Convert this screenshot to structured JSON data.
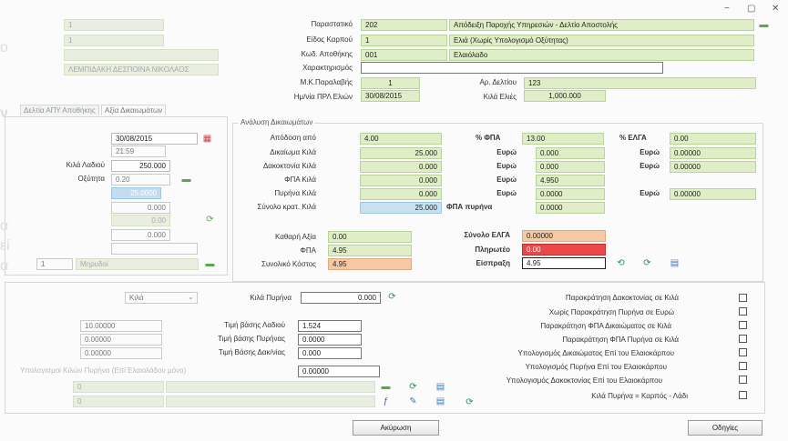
{
  "background": {
    "line1": "ο",
    "line2": "ν",
    "line3": "α",
    "line4": "εί",
    "line5": "α"
  },
  "window_controls": {
    "minimize": "−",
    "maximize": "▢",
    "close": "✕"
  },
  "left_faded": {
    "code1": "1",
    "code2": "1",
    "name": "ΛΕΜΠΙΔΑΚΗ ΔΕΣΠΟΙΝΑ ΝΙΚΟΛΑΟΣ",
    "tab1": "Δελτία ΑΠΥ Αποθήκης",
    "tab2": "Αξία Δικαιωμάτων"
  },
  "header": {
    "parastatiko_label": "Παραστατικό",
    "parastatiko_code": "202",
    "parastatiko_desc": "Απόδειξη Παροχής Υπηρεσιών - Δελτίο Αποστολής",
    "eidos_label": "Είδος Καρπού",
    "eidos_code": "1",
    "eidos_desc": "Ελιά (Χωρίς Υπολογισμό Οξύτητας)",
    "kod_label": "Κωδ. Αποθήκης",
    "kod_code": "001",
    "kod_desc": "Ελαιόλαδο",
    "xarakt_label": "Χαρακτηρισμός",
    "xarakt_value": "",
    "mk_label": "Μ.Κ.Παραλαβής",
    "mk_value": "1",
    "ar_label": "Αρ. Δελτίου",
    "ar_value": "123",
    "date_label": "Ημ/νία ΠΡΛ Ελιών",
    "date_value": "30/08/2015",
    "kila_label": "Κιλά Ελιές",
    "kila_value": "1,000.000"
  },
  "left_panel": {
    "date": "30/08/2015",
    "time": "21:59",
    "kila_ladiou_label": "Κιλά Λαδιού",
    "kila_ladiou_value": "250.000",
    "oxytita_label": "Οξύτητα",
    "oxytita_value": "0.20",
    "percent_value": "25.0000",
    "v1": "0.000",
    "v2": "0.00",
    "v3": "0.000",
    "num": "1",
    "mipheid_value": "Μηρυδοί"
  },
  "analysis": {
    "title": "Ανάλυση Δικαιωμάτων",
    "apodosi_label": "Απόδοση από",
    "apodosi_value": "4.00",
    "dikaioma_label": "Δικαίωμα Κιλά",
    "dikaioma_value": "25.000",
    "dakokt_label": "Δακοκτονία Κιλά",
    "dakokt_value": "0.000",
    "fpa_kila_label": "ΦΠΑ Κιλά",
    "fpa_kila_value": "0.000",
    "pyrina_label": "Πυρήνα Κιλά",
    "pyrina_value": "0.000",
    "synolo_label": "Σύνολο κρατ. Κιλά",
    "synolo_value": "25.000",
    "fpa_pct_label": "% ΦΠΑ",
    "fpa_pct_value": "13.00",
    "euro_label": "Ευρώ",
    "euro1": "0.000",
    "euro2": "0.000",
    "euro3": "4.950",
    "euro4": "0.0000",
    "fpa_pyrina_label": "ΦΠΑ πυρήνα",
    "fpa_pyrina_value": "0.0000",
    "elga_label": "% ΕΛΓΑ",
    "elga_value": "0.00",
    "elga_euro1": "0.00000",
    "elga_euro2": "0.00000",
    "elga_euro3": "0.00000"
  },
  "totals": {
    "katharh_label": "Καθαρή Αξία",
    "katharh_value": "0.00",
    "fpa_label": "ΦΠΑ",
    "fpa_value": "4.95",
    "synoliko_label": "Συνολικό Κόστος",
    "synoliko_value": "4.95",
    "synolo_elga_label": "Σύνολο ΕΛΓΑ",
    "synolo_elga_value": "0.00000",
    "plirwteo_label": "Πληρωτέο",
    "plirwteo_value": "0.00",
    "eispraxi_label": "Είσπραξη",
    "eispraxi_value": "4.95"
  },
  "lower_left": {
    "unit_select": "Κιλά",
    "kila_pyrina_label": "Κιλά Πυρήνα",
    "kila_pyrina_value": "0.000",
    "f1": "10.00000",
    "f2": "0.00000",
    "f3": "0.00000",
    "timi_ladiou_label": "Τιμή βάσης Λαδιού",
    "timi_ladiou_value": "1.524",
    "timi_pyrinas_label": "Τιμή βάσης Πυρήνας",
    "timi_pyrinas_value": "0.0000",
    "timi_dakon_label": "Τιμή Βάσης Δακ/νίας",
    "timi_dakon_value": "0.000",
    "ypol_label": "Υπολογισμοί Κιλών Πυρήνα (Επί Ελαιολάδου μόνο)",
    "ypol_value": "0.00000",
    "s1": "0",
    "s2": "0"
  },
  "options": {
    "opt1": "Παρακράτηση Δακοκτονίας σε Κιλά",
    "opt2": "Χωρίς Παρακράτηση Πυρήνα σε Ευρώ",
    "opt3": "Παρακράτηση ΦΠΑ Δικαιώματος σε Κιλά",
    "opt4": "Παρακράτηση ΦΠΑ Πυρήνα σε Κιλά",
    "opt5": "Υπολογισμός Δικαιώματος Επί του Ελαιοκάρπου",
    "opt6": "Υπολογισμός Πυρήνα Επί του Ελαιοκάρπου",
    "opt7": "Υπολογισμός Δακοκτονίας Επί του Ελαιοκάρπου",
    "opt8": "Κιλά Πυρήνα = Καρπός - Λάδι"
  },
  "buttons": {
    "cancel": "Ακύρωση",
    "instructions": "Οδηγίες"
  },
  "colors": {
    "field_green": "#dfeec6",
    "field_blue": "#c6e2f2",
    "field_orange": "#f6c9a5",
    "field_red": "#ea4848"
  }
}
